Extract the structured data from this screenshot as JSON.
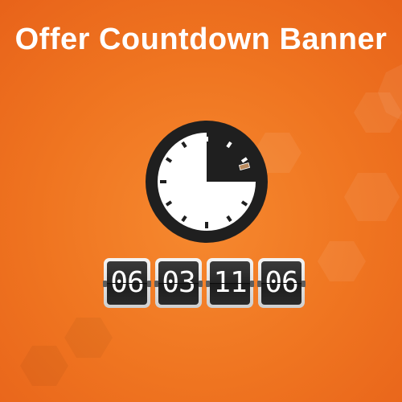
{
  "banner": {
    "title": "Offer Countdown Banner"
  },
  "clock": {
    "icon": "stopwatch-icon",
    "elapsed_fraction": 0.25
  },
  "countdown": {
    "digits": [
      "06",
      "03",
      "11",
      "06"
    ]
  },
  "colors": {
    "background": "#ef7420",
    "clock_dark": "#1f1f1f",
    "clock_face": "#ffffff",
    "digit_panel": "#262626",
    "digit_text": "#ffffff"
  }
}
